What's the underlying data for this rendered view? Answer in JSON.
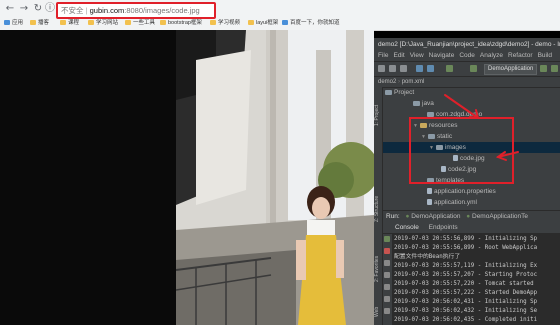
{
  "browser": {
    "address": {
      "secure": "不安全",
      "host": "gubin.com",
      "path": ":8080/images/code.jpg"
    },
    "bookmarks": [
      {
        "label": "应用",
        "icon": "apps-icon"
      },
      {
        "label": "播客",
        "icon": "folder-icon"
      },
      {
        "label": "课程",
        "icon": "folder-icon"
      },
      {
        "label": "学习网站",
        "icon": "folder-icon"
      },
      {
        "label": "一些工具",
        "icon": "folder-icon"
      },
      {
        "label": "bootstrap框架",
        "icon": "folder-icon"
      },
      {
        "label": "学习视频",
        "icon": "folder-icon"
      },
      {
        "label": "layui框架",
        "icon": "folder-icon"
      },
      {
        "label": "百度一下，你就知道",
        "icon": "baidu-icon"
      }
    ]
  },
  "ide": {
    "title": "demo2 [D:\\Java_Ruanjian\\project_idea\\zdgd\\demo2] - demo - IntelliJ IDEA",
    "menu": [
      "File",
      "Edit",
      "View",
      "Navigate",
      "Code",
      "Analyze",
      "Refactor",
      "Build"
    ],
    "run_config": "DemoApplication",
    "breadcrumb": [
      "demo2",
      "pom.xml"
    ],
    "side_tabs": [
      "1: Project",
      "Z: Structure",
      "2: Favorites",
      "Web"
    ],
    "tree": [
      {
        "label": "Project",
        "indent": 0,
        "type": "root"
      },
      {
        "label": "java",
        "indent": 2,
        "type": "folder"
      },
      {
        "label": "com.zdgd.demo",
        "indent": 3,
        "type": "folder"
      },
      {
        "label": "resources",
        "indent": 2,
        "type": "resfolder",
        "expanded": true
      },
      {
        "label": "static",
        "indent": 3,
        "type": "folder",
        "expanded": true
      },
      {
        "label": "images",
        "indent": 4,
        "type": "folder",
        "expanded": true,
        "selected": true
      },
      {
        "label": "code.jpg",
        "indent": 5,
        "type": "file"
      },
      {
        "label": "code2.jpg",
        "indent": 4,
        "type": "file"
      },
      {
        "label": "templates",
        "indent": 3,
        "type": "folder"
      },
      {
        "label": "application.properties",
        "indent": 3,
        "type": "file"
      },
      {
        "label": "application.yml",
        "indent": 3,
        "type": "file"
      }
    ],
    "run_bar": {
      "label": "Run:",
      "tabs": [
        "DemoApplication",
        "DemoApplicationTe"
      ]
    },
    "console_tabs": [
      "Console",
      "Endpoints"
    ],
    "console_lines": [
      "2019-07-03 20:55:56,899 - Initializing Sp",
      "2019-07-03 20:55:56,899 - Root WebApplica",
      "配置文件中的Bean执行了",
      "2019-07-03 20:55:57,119 - Initializing Ex",
      "2019-07-03 20:55:57,207 - Starting Protoc",
      "2019-07-03 20:55:57,220 - Tomcat started",
      "2019-07-03 20:55:57,222 - Started DemoApp",
      "2019-07-03 20:56:02,431 - Initializing Sp",
      "2019-07-03 20:56:02,432 - Initializing Se",
      "2019-07-03 20:56:02,435 - Completed initi"
    ]
  },
  "colors": {
    "annotation": "#e0202a",
    "ide_bg": "#3c3f41",
    "console_bg": "#2b2b2b"
  }
}
